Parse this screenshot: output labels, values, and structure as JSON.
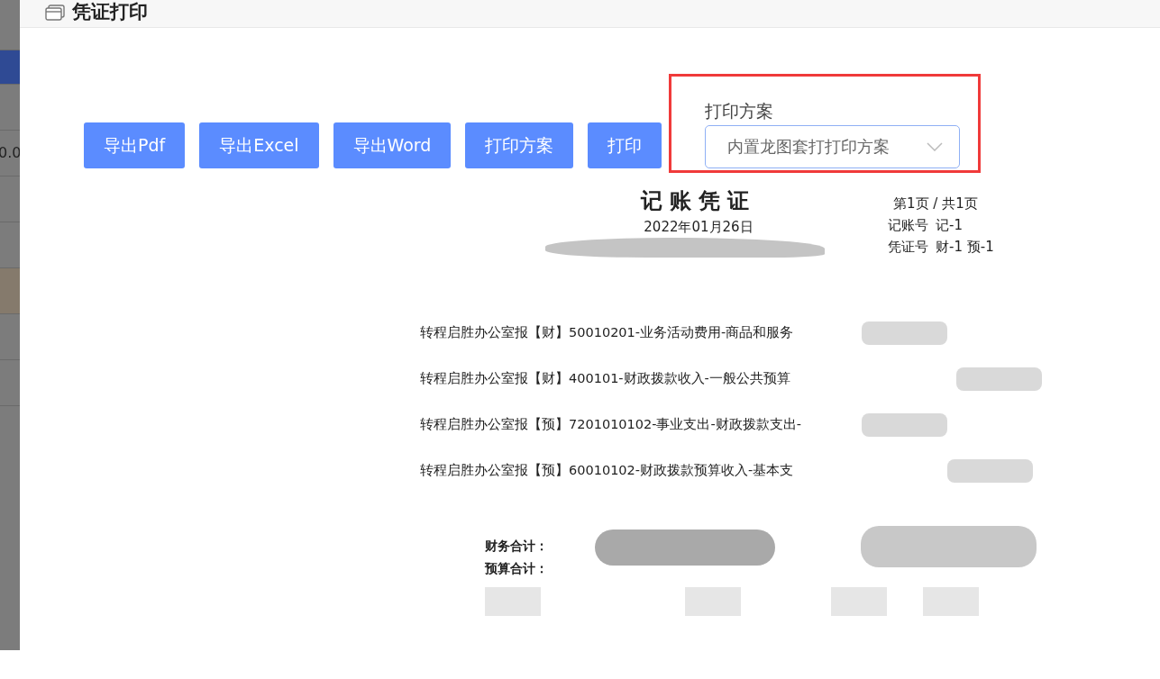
{
  "background": {
    "cell_text": "0.0"
  },
  "dialog": {
    "title": "凭证打印"
  },
  "toolbar": {
    "buttons": [
      "导出Pdf",
      "导出Excel",
      "导出Word",
      "打印方案",
      "打印"
    ]
  },
  "scheme_select": {
    "label": "打印方案",
    "value": "内置龙图套打打印方案",
    "highlighted": true
  },
  "voucher": {
    "title": "记账凭证",
    "date": "2022年01月26日",
    "page": "第1页 / 共1页",
    "numbers": [
      {
        "label": "记账号",
        "value": "记-1"
      },
      {
        "label": "凭证号",
        "value": "财-1  预-1"
      }
    ],
    "entries": [
      {
        "summary": "转程启胜办公室报",
        "account": "【财】50010201-业务活动费用-商品和服务"
      },
      {
        "summary": "转程启胜办公室报",
        "account": "【财】400101-财政拨款收入-一般公共预算"
      },
      {
        "summary": "转程启胜办公室报",
        "account": "【预】7201010102-事业支出-财政拨款支出-"
      },
      {
        "summary": "转程启胜办公室报",
        "account": "【预】60010102-财政拨款预算收入-基本支"
      }
    ],
    "totals": [
      "财务合计：",
      "预算合计："
    ]
  }
}
